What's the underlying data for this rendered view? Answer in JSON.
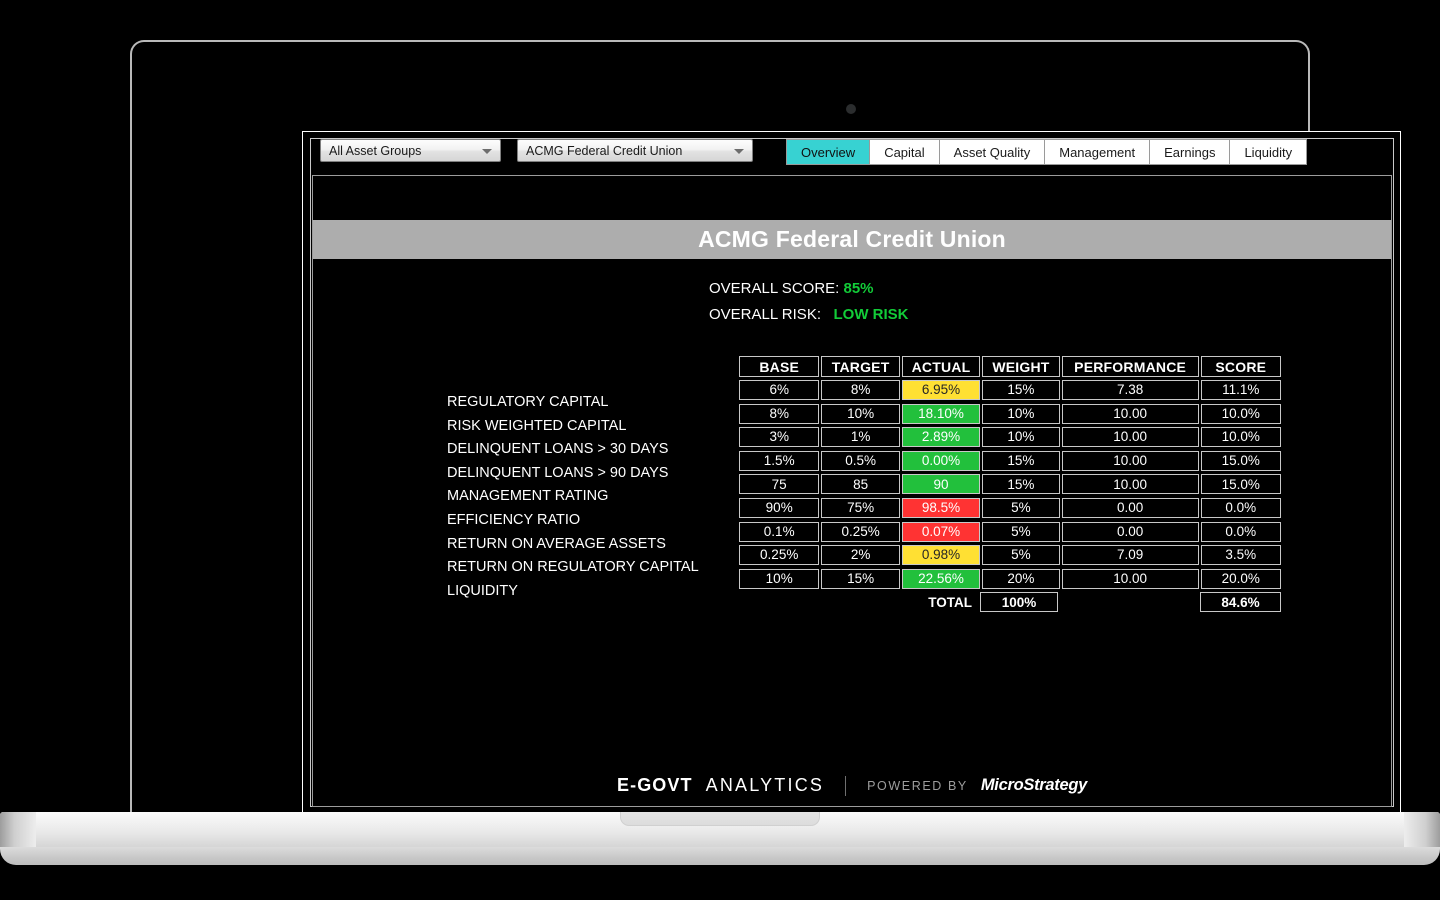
{
  "toolbar": {
    "asset_group_select": {
      "value": "All Asset Groups",
      "caret": "chevron-down-icon"
    },
    "institution_select": {
      "value": "ACMG Federal Credit Union",
      "caret": "chevron-down-icon"
    },
    "tabs": [
      {
        "label": "Overview",
        "active": true
      },
      {
        "label": "Capital",
        "active": false
      },
      {
        "label": "Asset Quality",
        "active": false
      },
      {
        "label": "Management",
        "active": false
      },
      {
        "label": "Earnings",
        "active": false
      },
      {
        "label": "Liquidity",
        "active": false
      }
    ],
    "active_tab_color": "#37d2d2"
  },
  "report": {
    "title": "ACMG Federal Credit Union",
    "title_bar_color": "#adadad",
    "summary": {
      "score_label": "OVERALL SCORE: ",
      "score_value": "85%",
      "risk_label": "OVERALL RISK:   ",
      "risk_value": "LOW RISK",
      "accent_color": "#12cc38"
    }
  },
  "chart_data": {
    "type": "table",
    "title": "ACMG Federal Credit Union Scorecard",
    "columns": [
      "BASE",
      "TARGET",
      "ACTUAL",
      "WEIGHT",
      "PERFORMANCE",
      "SCORE"
    ],
    "row_labels": [
      "REGULATORY CAPITAL",
      "RISK WEIGHTED CAPITAL",
      "DELINQUENT LOANS > 30 DAYS",
      "DELINQUENT LOANS > 90 DAYS",
      "MANAGEMENT RATING",
      "EFFICIENCY RATIO",
      "RETURN ON AVERAGE ASSETS",
      "RETURN ON REGULATORY CAPITAL",
      "LIQUIDITY"
    ],
    "rows": [
      {
        "label": "REGULATORY CAPITAL",
        "base": "6%",
        "target": "8%",
        "actual": "6.95%",
        "actual_status": "yellow",
        "weight": "15%",
        "performance": "7.38",
        "score": "11.1%"
      },
      {
        "label": "RISK WEIGHTED CAPITAL",
        "base": "8%",
        "target": "10%",
        "actual": "18.10%",
        "actual_status": "green",
        "weight": "10%",
        "performance": "10.00",
        "score": "10.0%"
      },
      {
        "label": "DELINQUENT LOANS > 30 DAYS",
        "base": "3%",
        "target": "1%",
        "actual": "2.89%",
        "actual_status": "green",
        "weight": "10%",
        "performance": "10.00",
        "score": "10.0%"
      },
      {
        "label": "DELINQUENT LOANS > 90 DAYS",
        "base": "1.5%",
        "target": "0.5%",
        "actual": "0.00%",
        "actual_status": "green",
        "weight": "15%",
        "performance": "10.00",
        "score": "15.0%"
      },
      {
        "label": "MANAGEMENT RATING",
        "base": "75",
        "target": "85",
        "actual": "90",
        "actual_status": "green",
        "weight": "15%",
        "performance": "10.00",
        "score": "15.0%"
      },
      {
        "label": "EFFICIENCY RATIO",
        "base": "90%",
        "target": "75%",
        "actual": "98.5%",
        "actual_status": "red",
        "weight": "5%",
        "performance": "0.00",
        "score": "0.0%"
      },
      {
        "label": "RETURN ON AVERAGE ASSETS",
        "base": "0.1%",
        "target": "0.25%",
        "actual": "0.07%",
        "actual_status": "red",
        "weight": "5%",
        "performance": "0.00",
        "score": "0.0%"
      },
      {
        "label": "RETURN ON REGULATORY CAPITAL",
        "base": "0.25%",
        "target": "2%",
        "actual": "0.98%",
        "actual_status": "yellow",
        "weight": "5%",
        "performance": "7.09",
        "score": "3.5%"
      },
      {
        "label": "LIQUIDITY",
        "base": "10%",
        "target": "15%",
        "actual": "22.56%",
        "actual_status": "green",
        "weight": "20%",
        "performance": "10.00",
        "score": "20.0%"
      }
    ],
    "total": {
      "label": "TOTAL",
      "weight": "100%",
      "score": "84.6%"
    },
    "status_colors": {
      "green": "#22c03c",
      "yellow": "#ffe033",
      "red": "#ff3333"
    }
  },
  "footer": {
    "brand_primary": "E-GOVT",
    "brand_secondary": "ANALYTICS",
    "powered_by": "POWERED BY",
    "vendor": "MicroStrategy"
  }
}
